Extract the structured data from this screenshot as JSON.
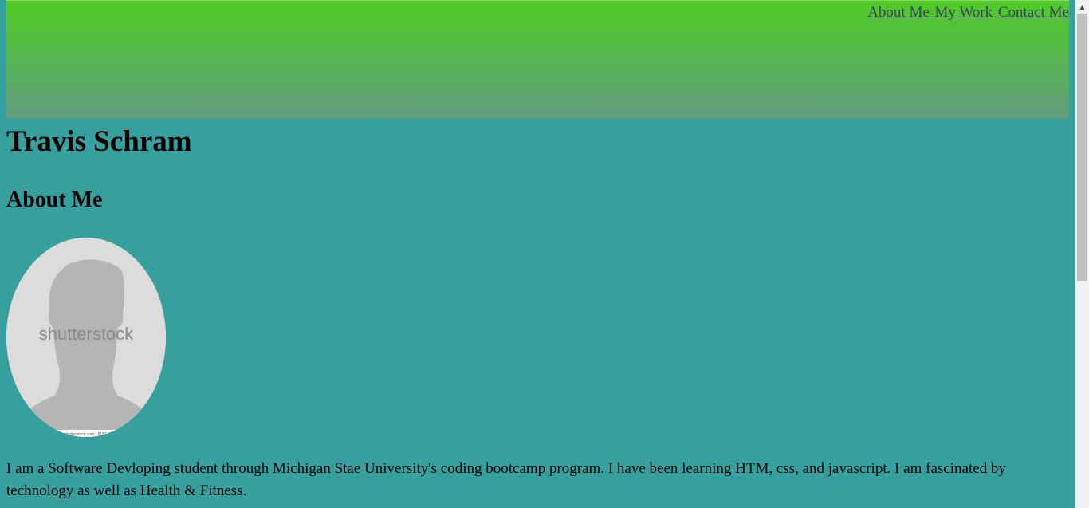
{
  "nav": {
    "items": [
      {
        "label": "About Me"
      },
      {
        "label": "My Work"
      },
      {
        "label": "Contact Me"
      }
    ]
  },
  "header": {
    "name": "Travis Schram"
  },
  "about": {
    "title": "About Me",
    "image_watermark": "shutterstock",
    "image_caption": "www.shutterstock.com · 518740741",
    "bio": "I am a Software Devloping student through Michigan Stae University's coding bootcamp program. I have been learning HTM, css, and javascript. I am fascinated by technology as well as Health & Fitness."
  },
  "colors": {
    "page_background": "#35a09e",
    "header_gradient_top": "#4fcb24",
    "header_gradient_bottom": "#629b7f",
    "link": "#3b3b6b",
    "avatar_background": "#dcdcdc",
    "silhouette": "#b5b5b5"
  },
  "icons": {
    "scroll_up": "chevron-up-icon"
  }
}
